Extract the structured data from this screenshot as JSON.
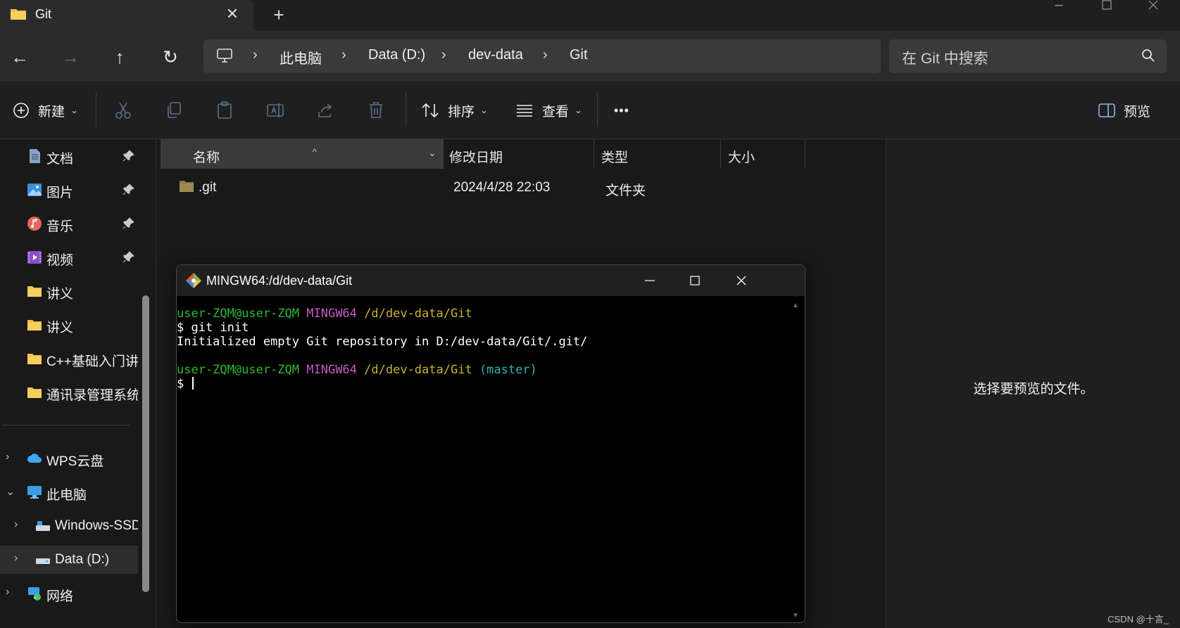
{
  "window": {
    "tab_title": "Git",
    "tab_close": "✕",
    "new_tab": "+"
  },
  "navigation": {
    "back": "←",
    "forward": "→",
    "up": "↑",
    "refresh": "↻",
    "breadcrumb": [
      "此电脑",
      "Data (D:)",
      "dev-data",
      "Git"
    ],
    "search_placeholder": "在 Git 中搜索"
  },
  "toolbar": {
    "new_label": "新建",
    "sort_label": "排序",
    "view_label": "查看",
    "more_label": "•••",
    "preview_label": "预览"
  },
  "sidebar": {
    "quick_access": [
      {
        "label": "文档",
        "icon": "documents-icon",
        "pinned": true
      },
      {
        "label": "图片",
        "icon": "pictures-icon",
        "pinned": true
      },
      {
        "label": "音乐",
        "icon": "music-icon",
        "pinned": true
      },
      {
        "label": "视频",
        "icon": "videos-icon",
        "pinned": true
      },
      {
        "label": "讲义",
        "icon": "folder-icon",
        "pinned": false
      },
      {
        "label": "讲义",
        "icon": "folder-icon",
        "pinned": false
      },
      {
        "label": "C++基础入门讲",
        "icon": "folder-icon",
        "pinned": false
      },
      {
        "label": "通讯录管理系统",
        "icon": "folder-icon",
        "pinned": false
      }
    ],
    "locations": [
      {
        "label": "WPS云盘",
        "icon": "cloud-icon",
        "expander": "›"
      },
      {
        "label": "此电脑",
        "icon": "computer-icon",
        "expander": "⌄"
      },
      {
        "label": "Windows-SSD",
        "icon": "drive-icon",
        "expander": "›"
      },
      {
        "label": "Data (D:)",
        "icon": "drive-icon",
        "expander": "›"
      },
      {
        "label": "网络",
        "icon": "network-icon",
        "expander": "›"
      }
    ]
  },
  "file_list": {
    "columns": [
      "名称",
      "修改日期",
      "类型",
      "大小"
    ],
    "rows": [
      {
        "name": ".git",
        "modified": "2024/4/28 22:03",
        "type": "文件夹",
        "size": ""
      }
    ]
  },
  "preview_pane": {
    "message": "选择要预览的文件。",
    "watermark": "CSDN @十言_"
  },
  "terminal": {
    "title": "MINGW64:/d/dev-data/Git",
    "lines": [
      {
        "user": "user-ZQM@user-ZQM",
        "env": "MINGW64",
        "path": "/d/dev-data/Git",
        "branch": ""
      },
      {
        "text": "$ git init"
      },
      {
        "text": "Initialized empty Git repository in D:/dev-data/Git/.git/"
      },
      {
        "text": ""
      },
      {
        "user": "user-ZQM@user-ZQM",
        "env": "MINGW64",
        "path": "/d/dev-data/Git",
        "branch": "(master)"
      },
      {
        "text": "$ "
      }
    ]
  },
  "colors": {
    "terminal_user": "#2eb82e",
    "terminal_env": "#c45cc4",
    "terminal_path": "#c7b32c",
    "terminal_branch": "#2bb3b3",
    "folder": "#f2c34b"
  }
}
